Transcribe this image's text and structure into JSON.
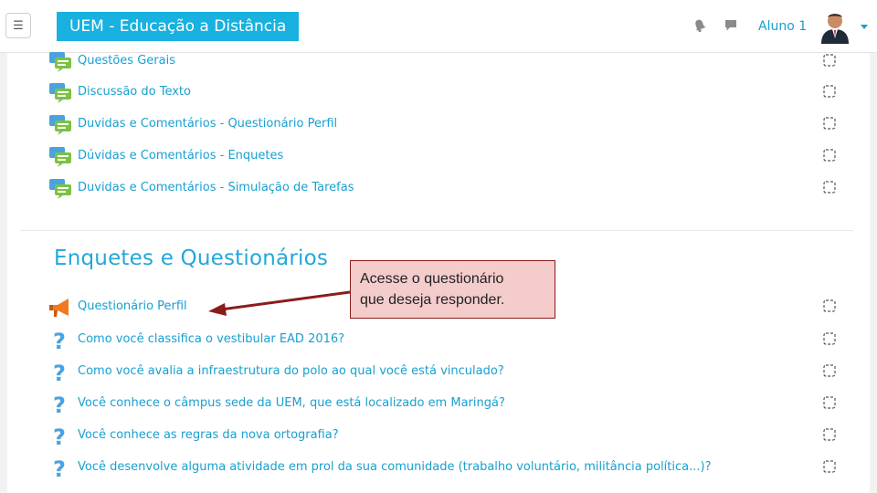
{
  "navbar": {
    "menu_icon": "hamburger-icon",
    "site_title": "UEM - Educação a Distância",
    "notification_icon": "bell-icon",
    "message_icon": "chat-icon",
    "user_name": "Aluno 1",
    "user_menu_icon": "chevron-down-icon"
  },
  "forums": [
    {
      "label": "Questões Gerais",
      "icon": "forum-icon"
    },
    {
      "label": "Discussão do Texto",
      "icon": "forum-icon"
    },
    {
      "label": "Duvidas e Comentários - Questionário Perfil",
      "icon": "forum-icon"
    },
    {
      "label": "Dúvidas e Comentários - Enquetes",
      "icon": "forum-icon"
    },
    {
      "label": "Duvidas e Comentários - Simulação de Tarefas",
      "icon": "forum-icon"
    }
  ],
  "section": {
    "title": "Enquetes e Questionários",
    "items": [
      {
        "label": "Questionário Perfil",
        "icon": "megaphone-icon"
      },
      {
        "label": "Como você classifica o vestibular EAD 2016?",
        "icon": "question-icon"
      },
      {
        "label": "Como você avalia a infraestrutura do polo ao qual você está vinculado?",
        "icon": "question-icon"
      },
      {
        "label": "Você conhece o câmpus sede da UEM, que está localizado em Maringá?",
        "icon": "question-icon"
      },
      {
        "label": "Você conhece as regras da nova ortografia?",
        "icon": "question-icon"
      },
      {
        "label": "Você desenvolve alguma atividade em prol da sua comunidade (trabalho voluntário, militância política...)?",
        "icon": "question-icon"
      }
    ]
  },
  "callout": {
    "line1": "Acesse o questionário",
    "line2": "que deseja responder."
  },
  "colors": {
    "accent": "#18b1e0",
    "link": "#18a0d0",
    "callout_bg": "#f4cccc",
    "callout_border": "#8a1c1c"
  }
}
